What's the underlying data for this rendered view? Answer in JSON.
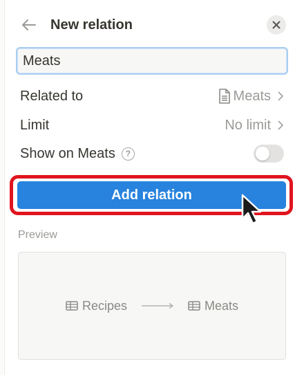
{
  "header": {
    "title": "New relation",
    "back_icon": "arrow-left-icon",
    "close_icon": "close-icon"
  },
  "name_input": {
    "value": "Meats"
  },
  "rows": {
    "related_to": {
      "label": "Related to",
      "value": "Meats",
      "icon": "page-icon"
    },
    "limit": {
      "label": "Limit",
      "value": "No limit"
    },
    "show_on": {
      "label": "Show on Meats",
      "help": "?",
      "toggle_on": false
    }
  },
  "add_button": {
    "label": "Add relation"
  },
  "preview": {
    "label": "Preview",
    "source": "Recipes",
    "target": "Meats",
    "icon": "table-icon"
  },
  "colors": {
    "accent": "#2783de",
    "highlight": "#e0141e",
    "muted": "#9b9a97"
  }
}
